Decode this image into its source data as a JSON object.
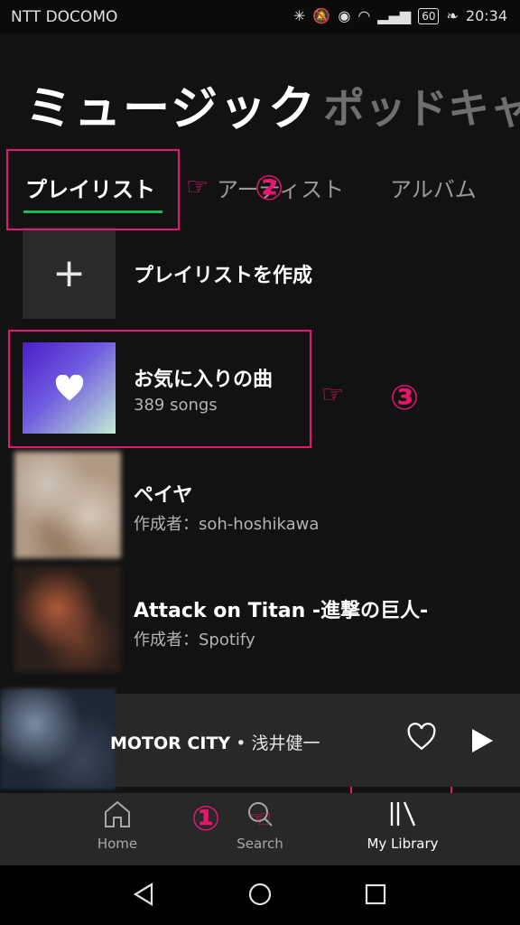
{
  "status_bar": {
    "carrier": "NTT DOCOMO",
    "battery": "60",
    "time": "20:34"
  },
  "header": {
    "tabs": [
      "ミュージック",
      "ポッドキャ"
    ]
  },
  "subtabs": [
    "プレイリスト",
    "アーティスト",
    "アルバム"
  ],
  "library": {
    "create_label": "プレイリストを作成",
    "items": [
      {
        "title": "お気に入りの曲",
        "subtitle": "389 songs"
      },
      {
        "title": "ペイヤ",
        "subtitle": "作成者：soh-hoshikawa"
      },
      {
        "title": "Attack on Titan -進撃の巨人-",
        "subtitle": "作成者：Spotify"
      }
    ]
  },
  "player": {
    "track": "MOTOR CITY",
    "separator": " • ",
    "artist": "浅井健一"
  },
  "bottom_nav": {
    "items": [
      "Home",
      "Search",
      "My Library"
    ]
  },
  "annotations": {
    "one": "①",
    "two": "②",
    "three": "③"
  },
  "colors": {
    "accent": "#1db954",
    "annotation": "#e5176e",
    "background": "#121212"
  }
}
